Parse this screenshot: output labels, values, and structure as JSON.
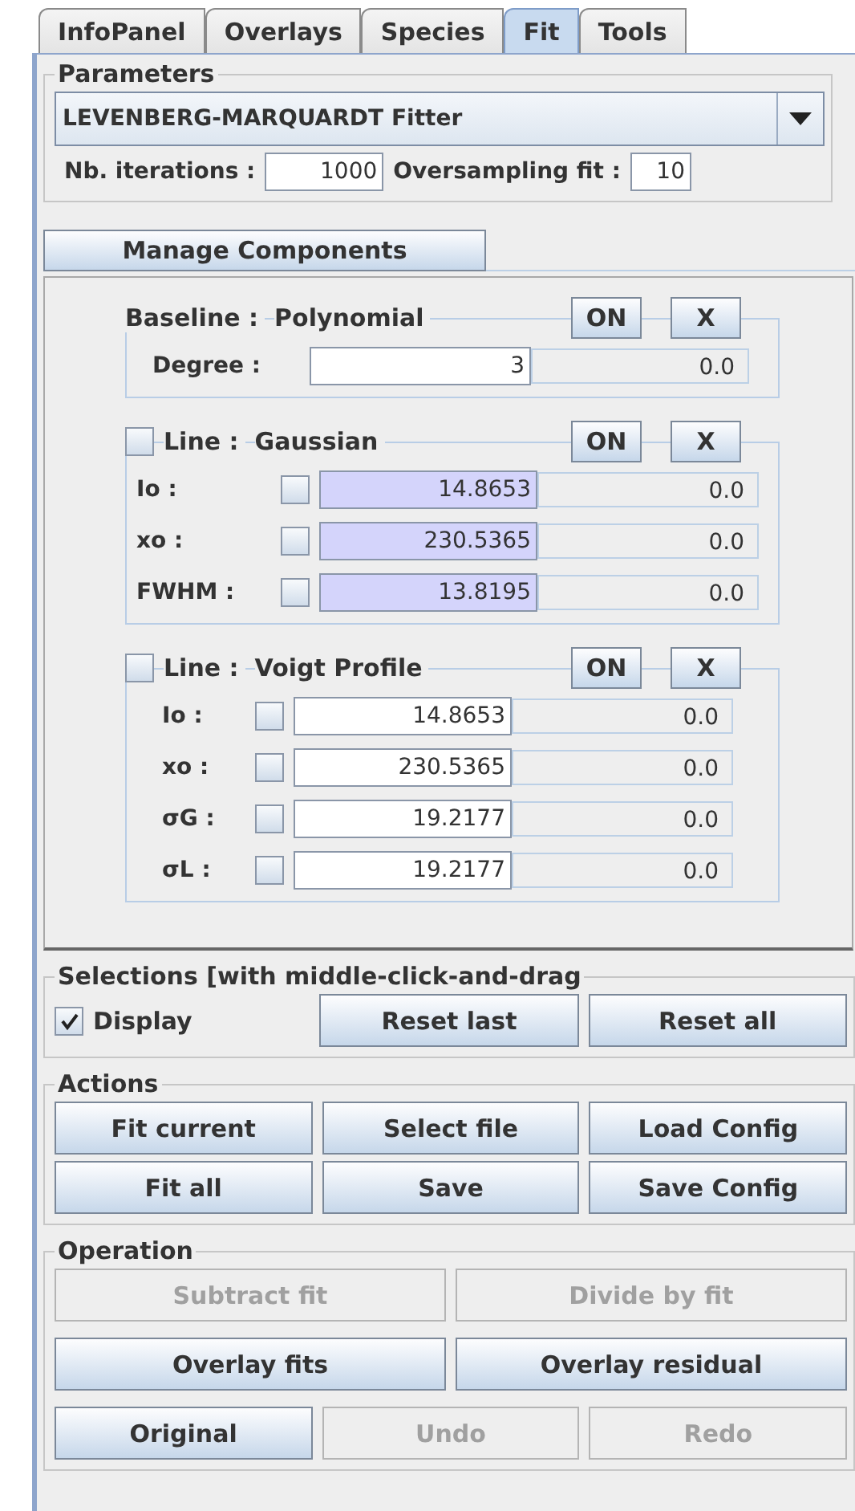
{
  "tabs": [
    {
      "label": "InfoPanel",
      "selected": false
    },
    {
      "label": "Overlays",
      "selected": false
    },
    {
      "label": "Species",
      "selected": false
    },
    {
      "label": "Fit",
      "selected": true
    },
    {
      "label": "Tools",
      "selected": false
    }
  ],
  "parameters": {
    "title": "Parameters",
    "fitter": "LEVENBERG-MARQUARDT Fitter",
    "iterations_label": "Nb. iterations :",
    "iterations": "1000",
    "oversampling_label": "Oversampling fit :",
    "oversampling": "10"
  },
  "manage_button": "Manage Components",
  "components": [
    {
      "kind": "baseline",
      "label": "Baseline :",
      "type": "Polynomial",
      "on_button": "ON",
      "remove_button": "X",
      "highlighted": false,
      "params": [
        {
          "label": "Degree :",
          "value": "3",
          "error": "0.0"
        }
      ]
    },
    {
      "kind": "line",
      "checked": false,
      "label": "Line :",
      "type": "Gaussian",
      "on_button": "ON",
      "remove_button": "X",
      "highlighted": true,
      "params": [
        {
          "label": "Io :",
          "fixed": false,
          "value": "14.8653",
          "error": "0.0"
        },
        {
          "label": "xo :",
          "fixed": false,
          "value": "230.5365",
          "error": "0.0"
        },
        {
          "label": "FWHM :",
          "fixed": false,
          "value": "13.8195",
          "error": "0.0"
        }
      ]
    },
    {
      "kind": "line",
      "checked": false,
      "label": "Line :",
      "type": "Voigt Profile",
      "on_button": "ON",
      "remove_button": "X",
      "highlighted": false,
      "params": [
        {
          "label": "Io :",
          "fixed": false,
          "value": "14.8653",
          "error": "0.0"
        },
        {
          "label": "xo :",
          "fixed": false,
          "value": "230.5365",
          "error": "0.0"
        },
        {
          "label": "σG :",
          "fixed": false,
          "value": "19.2177",
          "error": "0.0"
        },
        {
          "label": "σL :",
          "fixed": false,
          "value": "19.2177",
          "error": "0.0"
        }
      ]
    }
  ],
  "selections": {
    "title": "Selections [with middle-click-and-drag",
    "display": {
      "label": "Display",
      "checked": true
    },
    "buttons": [
      {
        "label": "Reset last",
        "disabled": false
      },
      {
        "label": "Reset all",
        "disabled": false
      }
    ]
  },
  "actions": {
    "title": "Actions",
    "buttons": [
      {
        "label": "Fit current",
        "disabled": false
      },
      {
        "label": "Select file",
        "disabled": false
      },
      {
        "label": "Load Config",
        "disabled": false
      },
      {
        "label": "Fit all",
        "disabled": false
      },
      {
        "label": "Save",
        "disabled": false
      },
      {
        "label": "Save Config",
        "disabled": false
      }
    ]
  },
  "operation": {
    "title": "Operation",
    "rows": [
      [
        {
          "label": "Subtract fit",
          "disabled": true
        },
        {
          "label": "Divide by fit",
          "disabled": true
        }
      ],
      [
        {
          "label": "Overlay fits",
          "disabled": false
        },
        {
          "label": "Overlay residual",
          "disabled": false
        }
      ],
      [
        {
          "label": "Original",
          "disabled": false
        },
        {
          "label": "Undo",
          "disabled": true
        },
        {
          "label": "Redo",
          "disabled": true
        }
      ]
    ]
  }
}
